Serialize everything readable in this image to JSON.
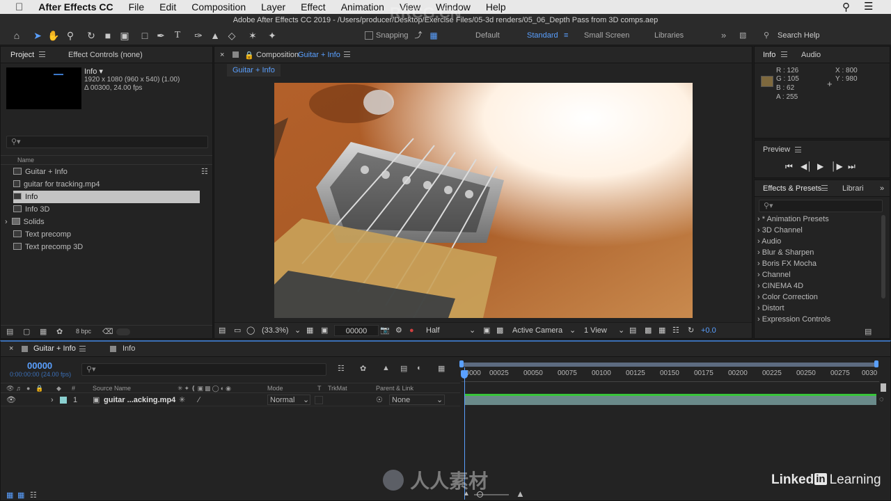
{
  "menubar": {
    "app": "After Effects CC",
    "items": [
      "File",
      "Edit",
      "Composition",
      "Layer",
      "Effect",
      "Animation",
      "View",
      "Window",
      "Help"
    ]
  },
  "toolbar": {
    "window_title": "Adobe After Effects CC 2019 - /Users/producer/Desktop/Exercise Files/05-3d renders/05_06_Depth Pass from 3D comps.aep",
    "snapping": "Snapping",
    "workspaces": [
      "Default",
      "Standard",
      "Small Screen",
      "Libraries"
    ],
    "active_workspace": "Standard",
    "search_help": "Search Help"
  },
  "project": {
    "tab_project": "Project",
    "tab_effect_controls": "Effect Controls (none)",
    "preview_name": "Info ▾",
    "preview_dims": "1920 x 1080  (960 x 540) (1.00)",
    "preview_duration": "Δ 00300, 24.00 fps",
    "column_name": "Name",
    "items": [
      {
        "label": "Guitar + Info",
        "type": "comp"
      },
      {
        "label": "guitar for tracking.mp4",
        "type": "footage"
      },
      {
        "label": "Info",
        "type": "comp",
        "selected": true
      },
      {
        "label": "Info 3D",
        "type": "comp"
      },
      {
        "label": "Solids",
        "type": "folder"
      },
      {
        "label": "Text precomp",
        "type": "comp"
      },
      {
        "label": "Text precomp 3D",
        "type": "comp"
      }
    ],
    "bpc": "8 bpc"
  },
  "composition": {
    "tab_prefix": "Composition",
    "tab_name": "Guitar + Info",
    "breadcrumb": "Guitar + Info",
    "zoom": "(33.3%)",
    "timecode": "00000",
    "resolution": "Half",
    "camera": "Active Camera",
    "views": "1 View",
    "exposure": "+0.0"
  },
  "info": {
    "tab_info": "Info",
    "tab_audio": "Audio",
    "r": "R : 126",
    "g": "G : 105",
    "b": "B : 62",
    "a": "A : 255",
    "x": "X : 800",
    "y": "Y : 980",
    "swatch_color": "#7e693e"
  },
  "preview": {
    "title": "Preview"
  },
  "effects": {
    "tab_effects": "Effects & Presets",
    "tab_libraries": "Librari",
    "items": [
      "* Animation Presets",
      "3D Channel",
      "Audio",
      "Blur & Sharpen",
      "Boris FX Mocha",
      "Channel",
      "CINEMA 4D",
      "Color Correction",
      "Distort",
      "Expression Controls"
    ]
  },
  "timeline": {
    "tab_comp": "Guitar + Info",
    "tab_info": "Info",
    "timecode": "00000",
    "timecode_sub": "0:00:00:00 (24.00 fps)",
    "col_source": "Source Name",
    "col_mode": "Mode",
    "col_t": "T",
    "col_trkmat": "TrkMat",
    "col_parent": "Parent & Link",
    "layer_num": "1",
    "layer_name": "guitar ...acking.mp4",
    "layer_mode": "Normal",
    "layer_parent": "None",
    "ruler": [
      "00000",
      "00025",
      "00050",
      "00075",
      "00100",
      "00125",
      "00150",
      "00175",
      "00200",
      "00225",
      "00250",
      "00275",
      "0030"
    ]
  },
  "branding": {
    "linkedin": "Linked",
    "linkedin_in": "in",
    "learning": "Learning",
    "watermark_top": "RRCG.CN",
    "watermark_bottom": "人人素材"
  }
}
